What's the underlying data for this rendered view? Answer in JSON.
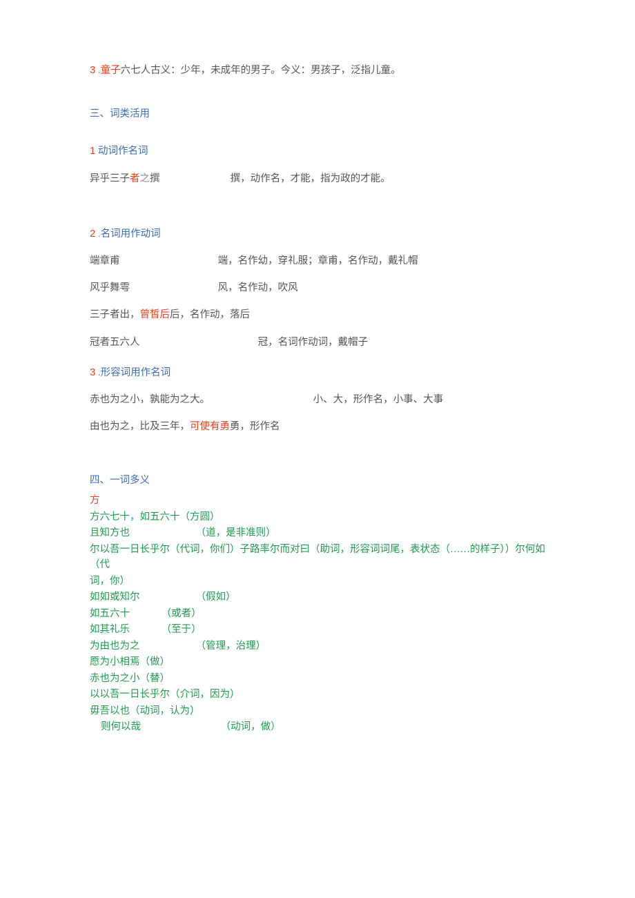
{
  "item3": {
    "num": "3",
    "dot": " .",
    "key": "童子",
    "rest": "六七人古义：少年，未成年的男子。今义：男孩子，泛指儿童。"
  },
  "section3": {
    "title": "三、词类活用",
    "sub1": {
      "num": "1",
      "title": " 动词作名词",
      "line1_a": "异乎三子",
      "line1_b": "者",
      "line1_c": "之",
      "line1_d": "撰",
      "line1_e": "撰，动作名，才能，指为政的才能。"
    },
    "sub2": {
      "num": "2",
      "dot": " .",
      "title": "名词用作动词",
      "l1a": "端章甫",
      "l1b": "端，名作幼，穿礼服；章甫，名作动，戴礼帽",
      "l2a": "风乎舞雩",
      "l2b": "风，名作动，吹风",
      "l3a": "三子者出，",
      "l3b": "曾皙后",
      "l3c": "后，名作动，落后",
      "l4a": "冠者五六人",
      "l4b": "冠，名词作动词，戴帽子"
    },
    "sub3": {
      "num": "3",
      "dot": " .",
      "title": "形容词用作名词",
      "l1a": "赤也为之小，孰能为之大。",
      "l1b": "小、大，形作名，小事、大事",
      "l2a": "由也为之，比及三年，",
      "l2b": "可使有勇",
      "l2c": "勇，形作名"
    }
  },
  "section4": {
    "title": "四、一词多义",
    "fang": "方",
    "l1": "方六七十，如五六十（方圆）",
    "l2a": "且知方也",
    "l2b": "（道，是非准则）",
    "l3": "尔以吾一日长乎尔（代词，你们）子路率尔而对曰（助词，形容词词尾，表状态（……的样子））尔何如（代",
    "l3b": "词，你）",
    "l4a": "如如或知尔",
    "l4b": "（假如）",
    "l5a": "如五六十",
    "l5b": "（或者）",
    "l6a": "如其礼乐",
    "l6b": "（至于）",
    "l7a": "为由也为之",
    "l7b": "（管理，治理）",
    "l8": "愿为小相焉（做）",
    "l9": "赤也为之小（替）",
    "l10": "以以吾一日长乎尔（介词，因为）",
    "l11": "毋吾以也（动词，认为）",
    "l12a": "则何以哉",
    "l12b": "（动词，做）"
  }
}
